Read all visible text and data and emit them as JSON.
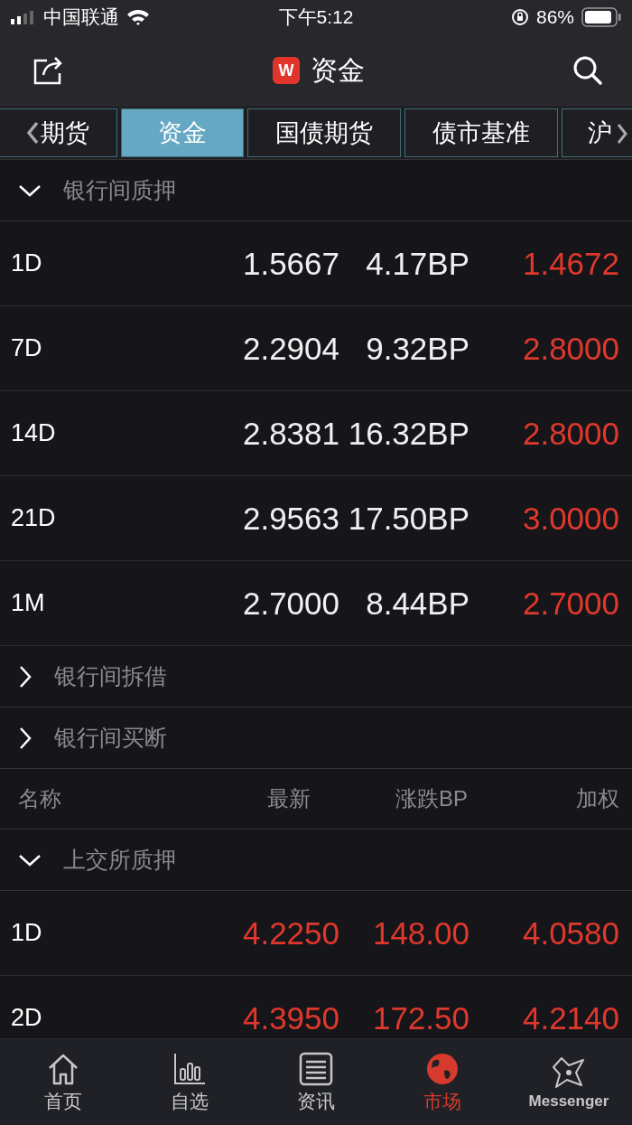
{
  "status_bar": {
    "carrier": "中国联通",
    "time": "下午5:12",
    "battery": "86%"
  },
  "nav": {
    "logo": "W",
    "title": "资金"
  },
  "tabs": [
    {
      "label": "期货",
      "selected": false
    },
    {
      "label": "资金",
      "selected": true
    },
    {
      "label": "国债期货",
      "selected": false
    },
    {
      "label": "债市基准",
      "selected": false
    },
    {
      "label": "沪",
      "selected": false
    }
  ],
  "blocks": [
    {
      "kind": "section",
      "title": "银行间质押",
      "expanded": true,
      "rows": [
        {
          "name": "1D",
          "latest": "1.5667",
          "latest_up": false,
          "change": "4.17BP",
          "change_up": false,
          "weighted": "1.4672",
          "weighted_up": true
        },
        {
          "name": "7D",
          "latest": "2.2904",
          "latest_up": false,
          "change": "9.32BP",
          "change_up": false,
          "weighted": "2.8000",
          "weighted_up": true
        },
        {
          "name": "14D",
          "latest": "2.8381",
          "latest_up": false,
          "change": "16.32BP",
          "change_up": false,
          "weighted": "2.8000",
          "weighted_up": true
        },
        {
          "name": "21D",
          "latest": "2.9563",
          "latest_up": false,
          "change": "17.50BP",
          "change_up": false,
          "weighted": "3.0000",
          "weighted_up": true
        },
        {
          "name": "1M",
          "latest": "2.7000",
          "latest_up": false,
          "change": "8.44BP",
          "change_up": false,
          "weighted": "2.7000",
          "weighted_up": true
        }
      ]
    },
    {
      "kind": "section",
      "title": "银行间拆借",
      "expanded": false
    },
    {
      "kind": "section",
      "title": "银行间买断",
      "expanded": false
    },
    {
      "kind": "header",
      "columns": [
        "名称",
        "最新",
        "涨跌BP",
        "加权"
      ]
    },
    {
      "kind": "section",
      "title": "上交所质押",
      "expanded": true,
      "rows": [
        {
          "name": "1D",
          "latest": "4.2250",
          "latest_up": true,
          "change": "148.00",
          "change_up": true,
          "weighted": "4.0580",
          "weighted_up": true
        },
        {
          "name": "2D",
          "latest": "4.3950",
          "latest_up": true,
          "change": "172.50",
          "change_up": true,
          "weighted": "4.2140",
          "weighted_up": true
        }
      ]
    }
  ],
  "bottom_tabs": [
    {
      "label": "首页",
      "selected": false
    },
    {
      "label": "自选",
      "selected": false
    },
    {
      "label": "资讯",
      "selected": false
    },
    {
      "label": "市场",
      "selected": true
    },
    {
      "label": "Messenger",
      "selected": false
    }
  ]
}
